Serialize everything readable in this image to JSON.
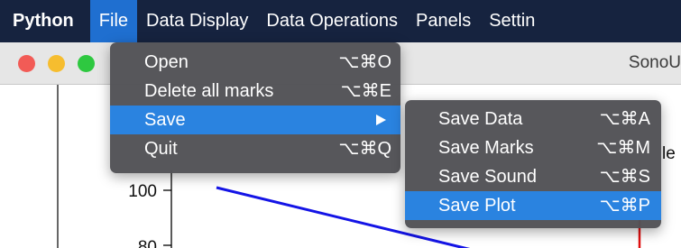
{
  "menubar": {
    "app": "Python",
    "items": [
      "File",
      "Data Display",
      "Data Operations",
      "Panels",
      "Settin"
    ]
  },
  "window": {
    "title": "SonoU"
  },
  "file_menu": {
    "items": [
      {
        "label": "Open",
        "shortcut": "⌥⌘O"
      },
      {
        "label": "Delete all marks",
        "shortcut": "⌥⌘E"
      },
      {
        "label": "Save",
        "shortcut": ""
      },
      {
        "label": "Quit",
        "shortcut": "⌥⌘Q"
      }
    ],
    "highlighted": "Save"
  },
  "save_menu": {
    "items": [
      {
        "label": "Save Data",
        "shortcut": "⌥⌘A"
      },
      {
        "label": "Save Marks",
        "shortcut": "⌥⌘M"
      },
      {
        "label": "Save Sound",
        "shortcut": "⌥⌘S"
      },
      {
        "label": "Save Plot",
        "shortcut": "⌥⌘P"
      }
    ],
    "highlighted": "Save Plot"
  },
  "plot": {
    "y_ticks": [
      "100",
      "80"
    ],
    "partial_title_text": "le",
    "line_color": "#1414e6",
    "marker_color": "#e01010"
  }
}
